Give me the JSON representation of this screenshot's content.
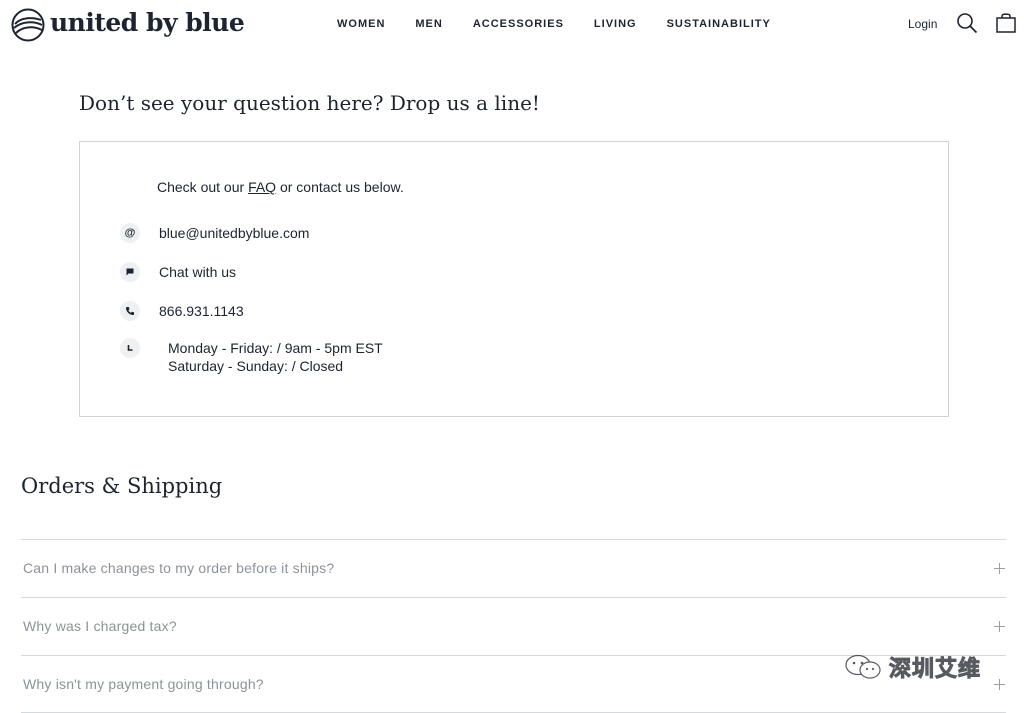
{
  "header": {
    "logo_text": "united by blue",
    "nav": [
      "WOMEN",
      "MEN",
      "ACCESSORIES",
      "LIVING",
      "SUSTAINABILITY"
    ],
    "login_label": "Login"
  },
  "contact": {
    "heading": "Don’t see your question here? Drop us a line!",
    "intro_before": "Check out our ",
    "intro_link": "FAQ",
    "intro_after": " or contact us below.",
    "email": "blue@unitedbyblue.com",
    "chat": "Chat with us",
    "phone": "866.931.1143",
    "hours_weekday": "Monday - Friday: / 9am - 5pm EST",
    "hours_weekend": "Saturday - Sunday: / Closed"
  },
  "orders": {
    "title": "Orders & Shipping",
    "questions": [
      "Can I make changes to my order before it ships?",
      "Why was I charged tax?",
      "Why isn't my payment going through?"
    ]
  },
  "watermark": {
    "text": "深圳艾维"
  }
}
